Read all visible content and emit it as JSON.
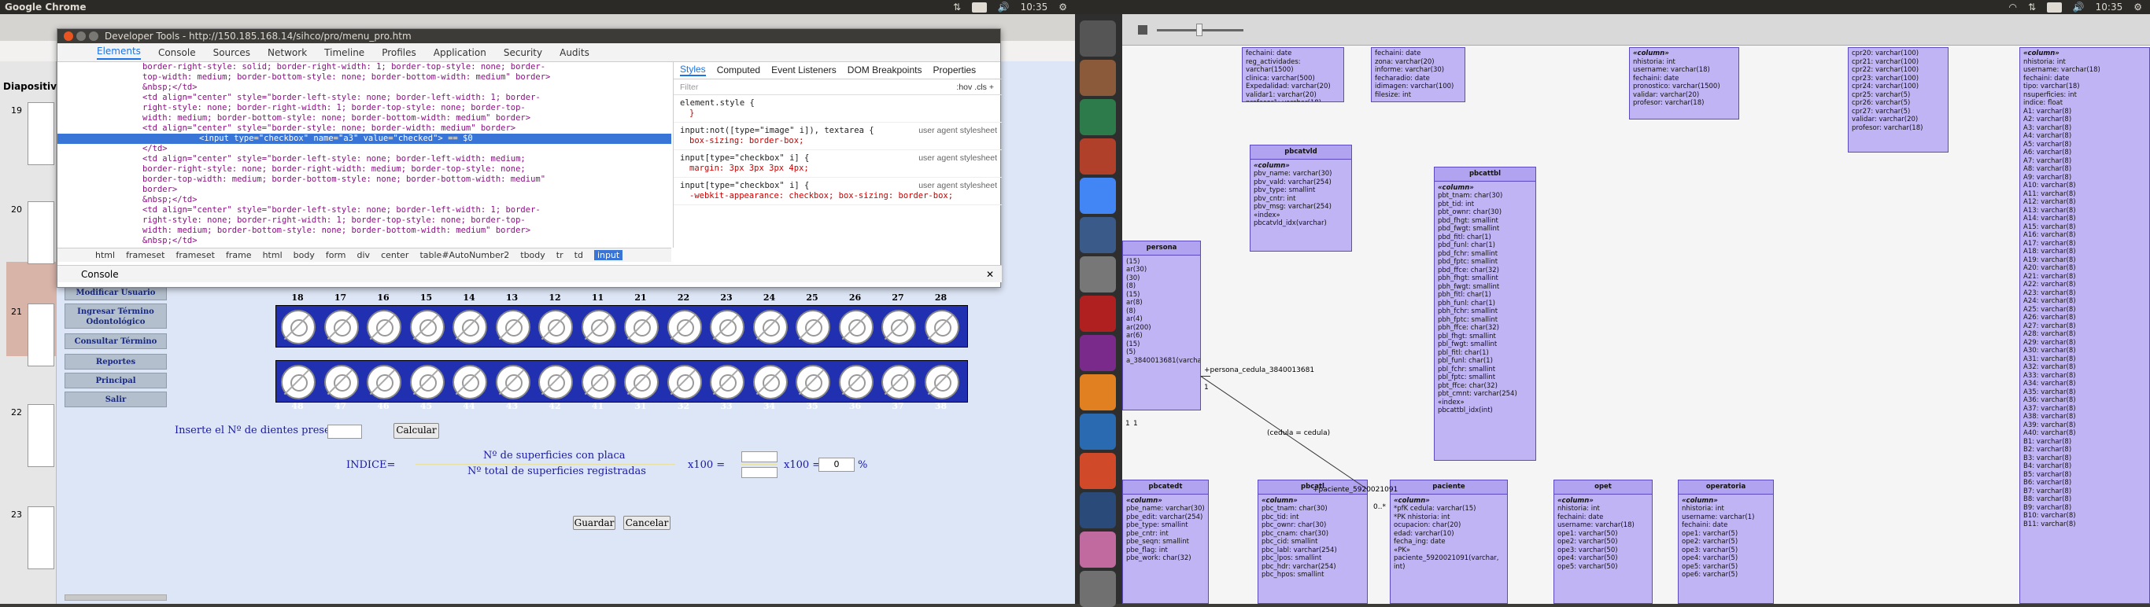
{
  "topbar": {
    "left_title": "Google Chrome",
    "time_left": "10:35",
    "time_right": "10:35",
    "kbd_left": "En",
    "kbd_right": "En"
  },
  "devtools": {
    "title": "Developer Tools - http://150.185.168.14/sihco/pro/menu_pro.htm",
    "tabs": [
      "Elements",
      "Console",
      "Sources",
      "Network",
      "Timeline",
      "Profiles",
      "Application",
      "Security",
      "Audits"
    ],
    "active_tab": "Elements",
    "code_lines": [
      "border-right-style: solid; border-right-width: 1; border-top-style: none; border-",
      "top-width: medium; border-bottom-style: none; border-bottom-width: medium\" border>",
      "&nbsp;</td>",
      "<td align=\"center\" style=\"border-left-style: none; border-left-width: 1; border-",
      "right-style: none; border-right-width: 1; border-top-style: none; border-top-",
      "width: medium; border-bottom-style: none; border-bottom-width: medium\" border>",
      "<td align=\"center\" style=\"border-style: none; border-width: medium\" border>",
      "<input type=\"checkbox\" name=\"a3\" value=\"checked\"> == $0",
      "</td>",
      "<td align=\"center\" style=\"border-left-style: none; border-left-width: medium;",
      "border-right-style: none; border-right-width: medium; border-top-style: none;",
      "border-top-width: medium; border-bottom-style: none; border-bottom-width: medium\"",
      "border>",
      "&nbsp;</td>",
      "<td align=\"center\" style=\"border-left-style: none; border-left-width: 1; border-",
      "right-style: none; border-right-width: 1; border-top-style: none; border-top-",
      "width: medium; border-bottom-style: none; border-bottom-width: medium\" border>",
      "&nbsp;</td>"
    ],
    "selected_line_index": 7,
    "styles_tabs": [
      "Styles",
      "Computed",
      "Event Listeners",
      "DOM Breakpoints",
      "Properties"
    ],
    "filter_placeholder": "Filter",
    "filter_toggles": ":hov  .cls  +",
    "rules": [
      {
        "selector": "element.style {",
        "body": "}",
        "source": ""
      },
      {
        "selector": "input:not([type=\"image\" i]), textarea {",
        "body": "box-sizing: border-box;",
        "source": "user agent stylesheet"
      },
      {
        "selector": "input[type=\"checkbox\" i] {",
        "body": "margin: 3px 3px 3px 4px;",
        "source": "user agent stylesheet"
      },
      {
        "selector": "input[type=\"checkbox\" i] {",
        "body": "-webkit-appearance: checkbox; box-sizing: border-box;",
        "source": "user agent stylesheet"
      }
    ],
    "breadcrumbs": [
      "html",
      "frameset",
      "frameset",
      "frame",
      "html",
      "body",
      "form",
      "div",
      "center",
      "table#AutoNumber2",
      "tbody",
      "tr",
      "td",
      "input"
    ],
    "console_label": "Console"
  },
  "slides": {
    "header": "Diapositiv",
    "numbers": [
      "19",
      "20",
      "21",
      "22",
      "23"
    ]
  },
  "menu": {
    "items": [
      "Modificar Usuario",
      "Ingresar Término Odontológico",
      "Consultar Término",
      "Reportes",
      "Principal",
      "Salir"
    ]
  },
  "teeth": {
    "top_row": [
      "18",
      "17",
      "16",
      "15",
      "14",
      "13",
      "12",
      "11",
      "21",
      "22",
      "23",
      "24",
      "25",
      "26",
      "27",
      "28"
    ],
    "bottom_row": [
      "48",
      "47",
      "46",
      "45",
      "44",
      "43",
      "42",
      "41",
      "31",
      "32",
      "33",
      "34",
      "35",
      "36",
      "37",
      "38"
    ]
  },
  "form": {
    "present_label": "Inserte el Nº de dientes presentes:",
    "calc_button": "Calcular",
    "indice_label": "INDICE=",
    "numerator": "Nº de superficies con placa",
    "denominator": "Nº total de superficies registradas",
    "x100_a": "x100 =",
    "x100_b": "x100 =",
    "result_value": "0",
    "percent": "%",
    "save_button": "Guardar",
    "cancel_button": "Cancelar"
  },
  "diagram": {
    "tables": [
      {
        "name": "",
        "stereotype": "",
        "lines": [
          "fechaini: date",
          "reg_actividades: varchar(1500)",
          "clinica: varchar(500)",
          "Expedalidad: varchar(20)",
          "validar1: varchar(20)",
          "profesor1: varchar(18)"
        ]
      },
      {
        "name": "",
        "stereotype": "",
        "lines": [
          "fechaini: date",
          "zona: varchar(20)",
          "informe: varchar(30)",
          "fecharadio: date",
          "idimagen: varchar(100)",
          "filesize: int"
        ]
      },
      {
        "name": "",
        "stereotype": "«column»",
        "lines": [
          "nhistoria: int",
          "username: varchar(18)",
          "fechaini: date",
          "pronostico: varchar(1500)",
          "validar: varchar(20)",
          "profesor: varchar(18)"
        ]
      },
      {
        "name": "",
        "stereotype": "",
        "lines": [
          "cpr20: varchar(100)",
          "cpr21: varchar(100)",
          "cpr22: varchar(100)",
          "cpr23: varchar(100)",
          "cpr24: varchar(100)",
          "cpr25: varchar(5)",
          "cpr26: varchar(5)",
          "cpr27: varchar(5)",
          "validar: varchar(20)",
          "profesor: varchar(18)"
        ]
      },
      {
        "name": "pbcatvld",
        "stereotype": "«column»",
        "lines": [
          "pbv_name: varchar(30)",
          "pbv_vald: varchar(254)",
          "pbv_type: smallint",
          "pbv_cntr: int",
          "pbv_msg: varchar(254)",
          "«index»",
          "pbcatvld_idx(varchar)"
        ]
      },
      {
        "name": "pbcattbl",
        "stereotype": "«column»",
        "lines": [
          "pbt_tnam: char(30)",
          "pbt_tid: int",
          "pbt_ownr: char(30)",
          "pbd_fhgt: smallint",
          "pbd_fwgt: smallint",
          "pbd_fitl: char(1)",
          "pbd_funl: char(1)",
          "pbd_fchr: smallint",
          "pbd_fptc: smallint",
          "pbd_ffce: char(32)",
          "pbh_fhgt: smallint",
          "pbh_fwgt: smallint",
          "pbh_fitl: char(1)",
          "pbh_funl: char(1)",
          "pbh_fchr: smallint",
          "pbh_fptc: smallint",
          "pbh_ffce: char(32)",
          "pbl_fhgt: smallint",
          "pbl_fwgt: smallint",
          "pbl_fitl: char(1)",
          "pbl_funl: char(1)",
          "pbl_fchr: smallint",
          "pbl_fptc: smallint",
          "pbt_ffce: char(32)",
          "pbt_cmnt: varchar(254)",
          "«index»",
          "pbcattbl_idx(int)"
        ]
      },
      {
        "name": "",
        "stereotype": "«column»",
        "lines": [
          "nhistoria: int",
          "username: varchar(18)",
          "fechaini: date",
          "tipo: varchar(18)",
          "nsuperficies: int",
          "indice: float",
          "A1: varchar(8)",
          "A2: varchar(8)",
          "A3: varchar(8)",
          "A4: varchar(8)",
          "A5: varchar(8)",
          "A6: varchar(8)",
          "A7: varchar(8)",
          "A8: varchar(8)",
          "A9: varchar(8)",
          "A10: varchar(8)",
          "A11: varchar(8)",
          "A12: varchar(8)",
          "A13: varchar(8)",
          "A14: varchar(8)",
          "A15: varchar(8)",
          "A16: varchar(8)",
          "A17: varchar(8)",
          "A18: varchar(8)",
          "A19: varchar(8)",
          "A20: varchar(8)",
          "A21: varchar(8)",
          "A22: varchar(8)",
          "A23: varchar(8)",
          "A24: varchar(8)",
          "A25: varchar(8)",
          "A26: varchar(8)",
          "A27: varchar(8)",
          "A28: varchar(8)",
          "A29: varchar(8)",
          "A30: varchar(8)",
          "A31: varchar(8)",
          "A32: varchar(8)",
          "A33: varchar(8)",
          "A34: varchar(8)",
          "A35: varchar(8)",
          "A36: varchar(8)",
          "A37: varchar(8)",
          "A38: varchar(8)",
          "A39: varchar(8)",
          "A40: varchar(8)",
          "B1: varchar(8)",
          "B2: varchar(8)",
          "B3: varchar(8)",
          "B4: varchar(8)",
          "B5: varchar(8)",
          "B6: varchar(8)",
          "B7: varchar(8)",
          "B8: varchar(8)",
          "B9: varchar(8)",
          "B10: varchar(8)",
          "B11: varchar(8)"
        ]
      },
      {
        "name": "pbcatedt",
        "stereotype": "«column»",
        "lines": [
          "pbe_name: varchar(30)",
          "pbe_edit: varchar(254)",
          "pbe_type: smallint",
          "pbe_cntr: int",
          "pbe_seqn: smallint",
          "pbe_flag: int",
          "pbe_work: char(32)"
        ]
      },
      {
        "name": "pbcatl",
        "stereotype": "«column»",
        "lines": [
          "pbc_tnam: char(30)",
          "pbc_tid: int",
          "pbc_ownr: char(30)",
          "pbc_cnam: char(30)",
          "pbc_cid: smallint",
          "pbc_labl: varchar(254)",
          "pbc_lpos: smallint",
          "pbc_hdr: varchar(254)",
          "pbc_hpos: smallint"
        ]
      },
      {
        "name": "paciente",
        "stereotype": "«column»",
        "lines": [
          "*pfK cedula: varchar(15)",
          "*PK nhistoria: int",
          "ocupacion: char(20)",
          "edad: varchar(10)",
          "fecha_ing: date",
          "«PK»",
          "paciente_5920021091(varchar, int)"
        ]
      },
      {
        "name": "opet",
        "stereotype": "«column»",
        "lines": [
          "nhistoria: int",
          "fechaini: date",
          "username: varchar(18)",
          "ope1: varchar(50)",
          "ope2: varchar(50)",
          "ope3: varchar(50)",
          "ope4: varchar(50)",
          "ope5: varchar(50)"
        ]
      },
      {
        "name": "operatoria",
        "stereotype": "«column»",
        "lines": [
          "nhistoria: int",
          "username: varchar(1)",
          "fechaini: date",
          "ope1: varchar(5)",
          "ope2: varchar(5)",
          "ope3: varchar(5)",
          "ope4: varchar(5)",
          "ope5: varchar(5)",
          "ope6: varchar(5)"
        ]
      },
      {
        "name": "persona",
        "stereotype": "",
        "lines": [
          "(15)",
          "ar(30)",
          "(30)",
          "",
          "(8)",
          "(15)",
          "ar(8)",
          "(8)",
          "ar(4)",
          "ar(200)",
          "ar(6)",
          "(15)",
          "",
          "(5)",
          "",
          "",
          "a_3840013681(varchar)"
        ]
      }
    ],
    "connector_labels": [
      "+persona_cedula_3840013681",
      "(cedula = cedula)",
      "+paciente_5920021091",
      "1",
      "0..*",
      "1",
      "1"
    ]
  }
}
